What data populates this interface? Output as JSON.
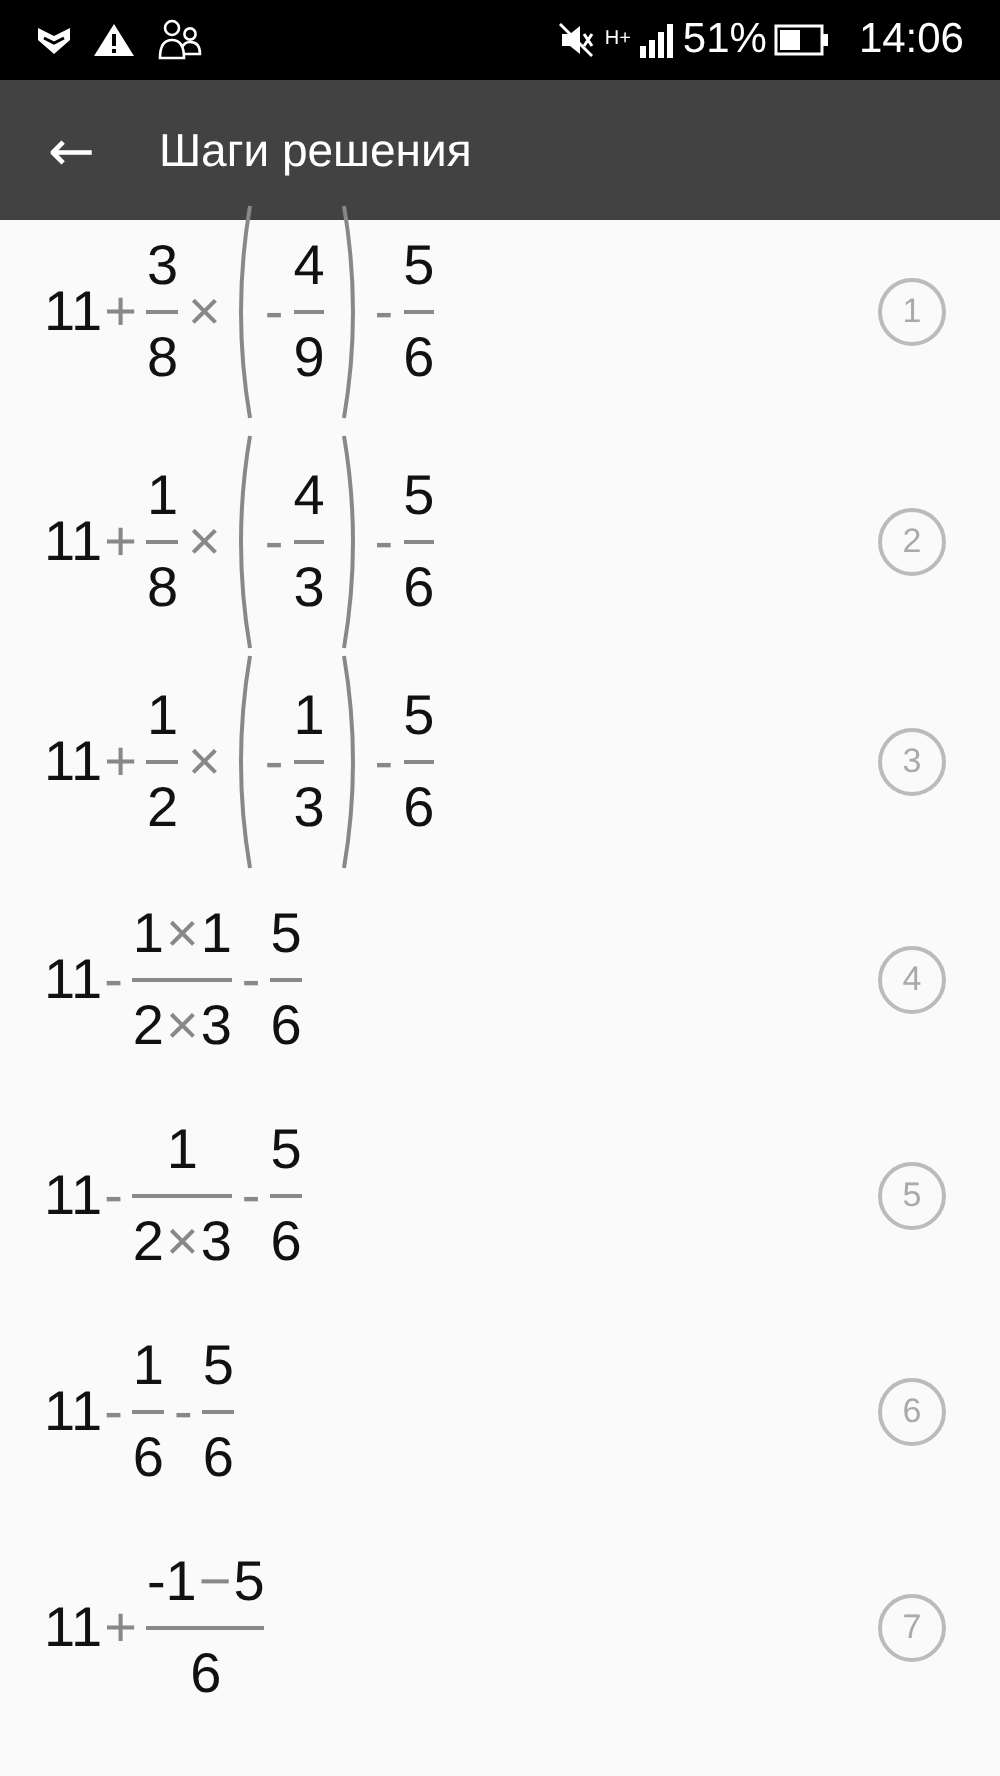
{
  "status_bar": {
    "network": "H+",
    "battery": "51%",
    "time": "14:06"
  },
  "app_bar": {
    "back": "←",
    "title": "Шаги решения"
  },
  "steps": [
    {
      "number": "1",
      "lead": "11",
      "terms": [
        {
          "kind": "frac",
          "op": "+",
          "num": [
            {
              "kind": "num",
              "text": "3"
            }
          ],
          "den": [
            {
              "kind": "num",
              "text": "8"
            }
          ]
        },
        {
          "kind": "paren",
          "op": "×",
          "terms": [
            {
              "kind": "frac",
              "op": "-",
              "num": [
                {
                  "kind": "num",
                  "text": "4"
                }
              ],
              "den": [
                {
                  "kind": "num",
                  "text": "9"
                }
              ]
            }
          ]
        },
        {
          "kind": "frac",
          "op": "-",
          "num": [
            {
              "kind": "num",
              "text": "5"
            }
          ],
          "den": [
            {
              "kind": "num",
              "text": "6"
            }
          ]
        }
      ]
    },
    {
      "number": "2",
      "lead": "11",
      "terms": [
        {
          "kind": "frac",
          "op": "+",
          "num": [
            {
              "kind": "num",
              "text": "1"
            }
          ],
          "den": [
            {
              "kind": "num",
              "text": "8"
            }
          ]
        },
        {
          "kind": "paren",
          "op": "×",
          "terms": [
            {
              "kind": "frac",
              "op": "-",
              "num": [
                {
                  "kind": "num",
                  "text": "4"
                }
              ],
              "den": [
                {
                  "kind": "num",
                  "text": "3"
                }
              ]
            }
          ]
        },
        {
          "kind": "frac",
          "op": "-",
          "num": [
            {
              "kind": "num",
              "text": "5"
            }
          ],
          "den": [
            {
              "kind": "num",
              "text": "6"
            }
          ]
        }
      ]
    },
    {
      "number": "3",
      "lead": "11",
      "terms": [
        {
          "kind": "frac",
          "op": "+",
          "num": [
            {
              "kind": "num",
              "text": "1"
            }
          ],
          "den": [
            {
              "kind": "num",
              "text": "2"
            }
          ]
        },
        {
          "kind": "paren",
          "op": "×",
          "terms": [
            {
              "kind": "frac",
              "op": "-",
              "num": [
                {
                  "kind": "num",
                  "text": "1"
                }
              ],
              "den": [
                {
                  "kind": "num",
                  "text": "3"
                }
              ]
            }
          ]
        },
        {
          "kind": "frac",
          "op": "-",
          "num": [
            {
              "kind": "num",
              "text": "5"
            }
          ],
          "den": [
            {
              "kind": "num",
              "text": "6"
            }
          ]
        }
      ]
    },
    {
      "number": "4",
      "lead": "11",
      "terms": [
        {
          "kind": "frac",
          "op": "-",
          "num": [
            {
              "kind": "num",
              "text": "1"
            },
            {
              "kind": "op",
              "text": "×"
            },
            {
              "kind": "num",
              "text": "1"
            }
          ],
          "den": [
            {
              "kind": "num",
              "text": "2"
            },
            {
              "kind": "op",
              "text": "×"
            },
            {
              "kind": "num",
              "text": "3"
            }
          ]
        },
        {
          "kind": "frac",
          "op": "-",
          "num": [
            {
              "kind": "num",
              "text": "5"
            }
          ],
          "den": [
            {
              "kind": "num",
              "text": "6"
            }
          ]
        }
      ]
    },
    {
      "number": "5",
      "lead": "11",
      "terms": [
        {
          "kind": "frac",
          "op": "-",
          "num": [
            {
              "kind": "num",
              "text": "1"
            }
          ],
          "den": [
            {
              "kind": "num",
              "text": "2"
            },
            {
              "kind": "op",
              "text": "×"
            },
            {
              "kind": "num",
              "text": "3"
            }
          ]
        },
        {
          "kind": "frac",
          "op": "-",
          "num": [
            {
              "kind": "num",
              "text": "5"
            }
          ],
          "den": [
            {
              "kind": "num",
              "text": "6"
            }
          ]
        }
      ]
    },
    {
      "number": "6",
      "lead": "11",
      "terms": [
        {
          "kind": "frac",
          "op": "-",
          "num": [
            {
              "kind": "num",
              "text": "1"
            }
          ],
          "den": [
            {
              "kind": "num",
              "text": "6"
            }
          ]
        },
        {
          "kind": "frac",
          "op": "-",
          "num": [
            {
              "kind": "num",
              "text": "5"
            }
          ],
          "den": [
            {
              "kind": "num",
              "text": "6"
            }
          ]
        }
      ]
    },
    {
      "number": "7",
      "lead": "11",
      "terms": [
        {
          "kind": "frac",
          "op": "+",
          "num": [
            {
              "kind": "num",
              "text": "-1"
            },
            {
              "kind": "op",
              "text": "−"
            },
            {
              "kind": "num",
              "text": "5"
            }
          ],
          "den": [
            {
              "kind": "num",
              "text": "6"
            }
          ]
        }
      ]
    }
  ]
}
